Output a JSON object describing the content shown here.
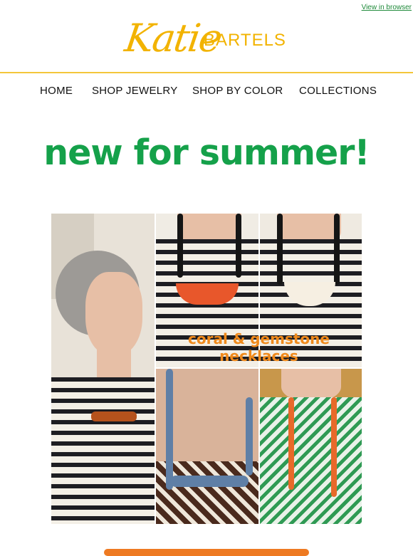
{
  "header": {
    "view_link": "View in browser",
    "logo_script": "Katie",
    "logo_brand": "BARTELS"
  },
  "nav": {
    "items": [
      {
        "label": "HOME"
      },
      {
        "label": "SHOP JEWELRY"
      },
      {
        "label": "SHOP BY COLOR"
      },
      {
        "label": "COLLECTIONS"
      }
    ]
  },
  "hero": {
    "headline": "new for summer!"
  },
  "collage": {
    "overlay_text_line1": "coral & gemstone",
    "overlay_text_line2": "necklaces"
  },
  "colors": {
    "brand_yellow": "#f2b300",
    "headline_green": "#15a14a",
    "accent_orange": "#f08a1c"
  }
}
